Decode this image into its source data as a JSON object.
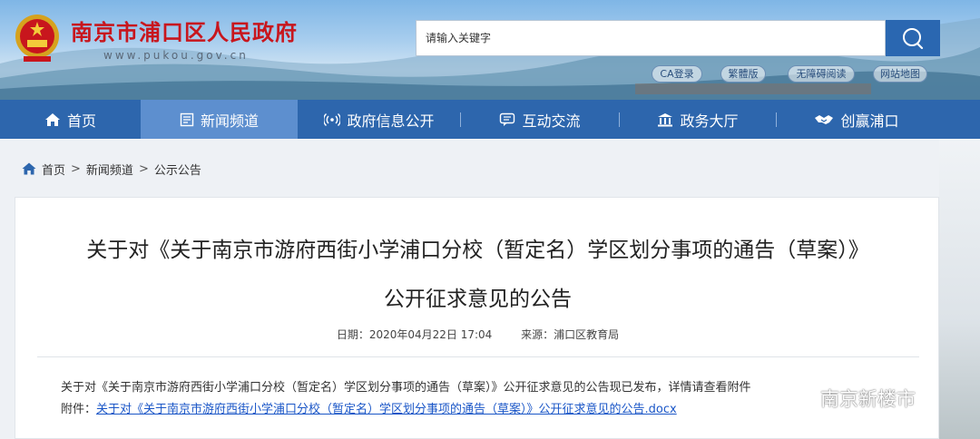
{
  "header": {
    "site_title": "南京市浦口区人民政府",
    "site_url": "www.pukou.gov.cn",
    "search": {
      "placeholder": "请输入关键字"
    },
    "quick_links": [
      "CA登录",
      "繁體版",
      "无障碍阅读",
      "网站地图"
    ]
  },
  "nav": {
    "items": [
      {
        "label": "首页",
        "icon": "home-icon"
      },
      {
        "label": "新闻频道",
        "icon": "news-icon",
        "active": true
      },
      {
        "label": "政府信息公开",
        "icon": "broadcast-icon"
      },
      {
        "label": "互动交流",
        "icon": "chat-icon"
      },
      {
        "label": "政务大厅",
        "icon": "building-icon"
      },
      {
        "label": "创赢浦口",
        "icon": "handshake-icon"
      }
    ]
  },
  "breadcrumb": {
    "items": [
      "首页",
      "新闻频道",
      "公示公告"
    ],
    "separator": ">"
  },
  "article": {
    "title_line1": "关于对《关于南京市游府西街小学浦口分校（暂定名）学区划分事项的通告（草案）》",
    "title_line2": "公开征求意见的公告",
    "date_label": "日期：2020年04月22日 17:04",
    "source_label": "来源：浦口区教育局",
    "body": "关于对《关于南京市游府西街小学浦口分校（暂定名）学区划分事项的通告（草案）》公开征求意见的公告现已发布，详情请查看附件",
    "attachment_label": "附件：",
    "attachment_link": "关于对《关于南京市游府西街小学浦口分校（暂定名）学区划分事项的通告（草案）》公开征求意见的公告.docx"
  },
  "watermark": {
    "text": "南京新楼市",
    "icon": "wechat-icon"
  },
  "colors": {
    "nav_bg": "#2d66ad",
    "nav_active": "#5d8fcf",
    "title_red": "#c8161d",
    "link_blue": "#1a56c7"
  }
}
